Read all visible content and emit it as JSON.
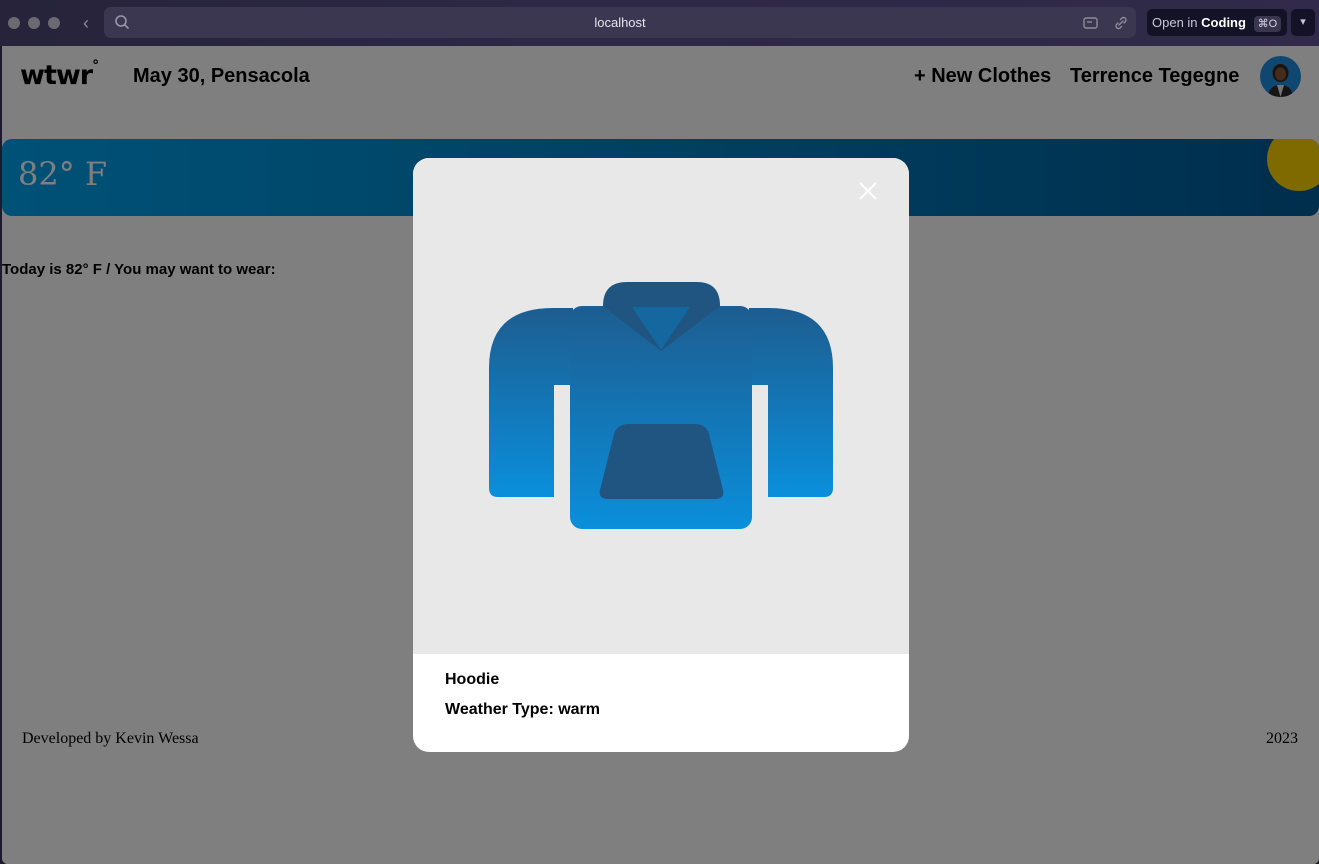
{
  "browser": {
    "url": "localhost",
    "open_in_prefix": "Open in",
    "open_in_app": "Coding",
    "open_in_shortcut": "⌘O"
  },
  "header": {
    "logo": "wtwr",
    "logo_mark": "°",
    "date_location": "May 30, Pensacola",
    "add_clothes": "+ New Clothes",
    "username": "Terrence Tegegne"
  },
  "weather": {
    "temperature": "82° F",
    "sun_color": "#ffd400",
    "card_color": "#0085c8"
  },
  "main": {
    "recommendation": "Today is 82° F / You may want to wear:"
  },
  "footer": {
    "credit": "Developed by Kevin Wessa",
    "year": "2023"
  },
  "modal": {
    "item_name": "Hoodie",
    "weather_type": "Weather Type: warm",
    "image_icon": "hoodie-icon",
    "close_icon": "close-icon"
  }
}
